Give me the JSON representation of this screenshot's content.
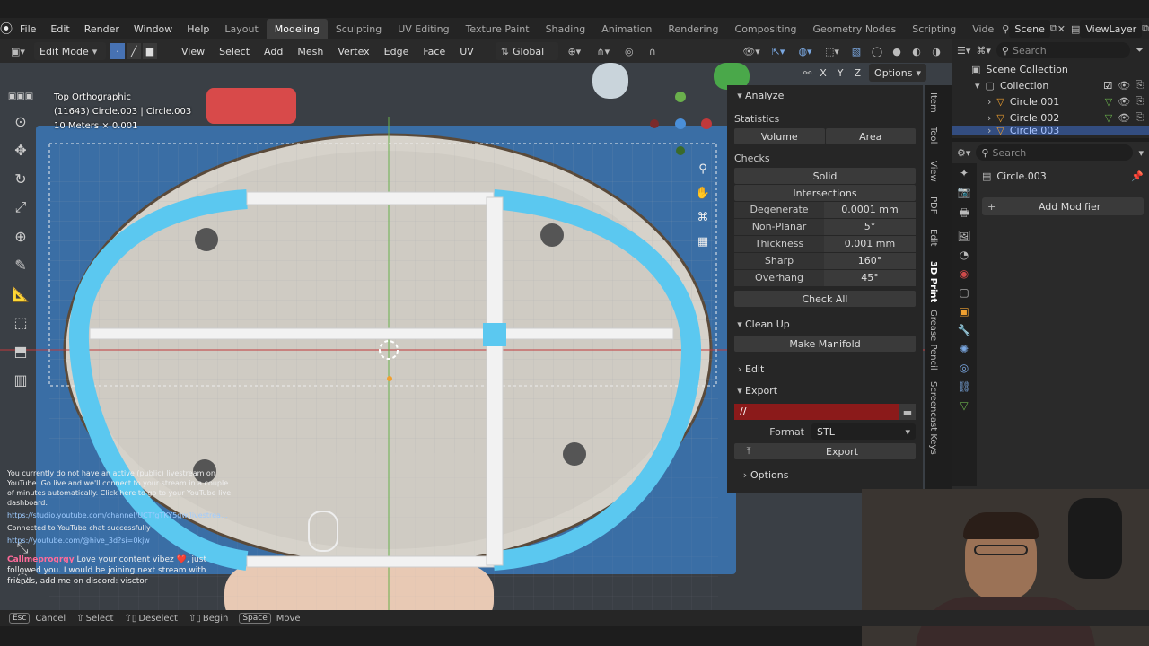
{
  "topbar": {
    "menus": [
      "File",
      "Edit",
      "Render",
      "Window",
      "Help"
    ],
    "workspaces": [
      "Layout",
      "Modeling",
      "Sculpting",
      "UV Editing",
      "Texture Paint",
      "Shading",
      "Animation",
      "Rendering",
      "Compositing",
      "Geometry Nodes",
      "Scripting",
      "Vide"
    ],
    "active_workspace": "Modeling",
    "scene": "Scene",
    "view_layer": "ViewLayer"
  },
  "header": {
    "mode": "Edit Mode",
    "menus": [
      "View",
      "Select",
      "Add",
      "Mesh",
      "Vertex",
      "Edge",
      "Face",
      "UV"
    ],
    "orientation": "Global",
    "axes": [
      "X",
      "Y",
      "Z"
    ],
    "options": "Options"
  },
  "viewport": {
    "view_name": "Top Orthographic",
    "object_info": "(11643) Circle.003 | Circle.003",
    "scale_info": "10 Meters × 0.001"
  },
  "npanel": {
    "analyze": "Analyze",
    "statistics": "Statistics",
    "volume": "Volume",
    "area": "Area",
    "checks": "Checks",
    "solid": "Solid",
    "intersections": "Intersections",
    "check_rows": [
      {
        "label": "Degenerate",
        "value": "0.0001 mm"
      },
      {
        "label": "Non-Planar",
        "value": "5°"
      },
      {
        "label": "Thickness",
        "value": "0.001 mm"
      },
      {
        "label": "Sharp",
        "value": "160°"
      },
      {
        "label": "Overhang",
        "value": "45°"
      }
    ],
    "check_all": "Check All",
    "clean_up": "Clean Up",
    "make_manifold": "Make Manifold",
    "edit": "Edit",
    "export_section": "Export",
    "export_path": "//",
    "format_label": "Format",
    "format_value": "STL",
    "export_button": "Export",
    "options": "Options"
  },
  "vtabs": [
    "Item",
    "Tool",
    "View",
    "PDF",
    "Edit",
    "3D Print",
    "Grease Pencil",
    "Screencast Keys"
  ],
  "outliner": {
    "search_placeholder": "Search",
    "scene_collection": "Scene Collection",
    "collection": "Collection",
    "items": [
      "Circle.001",
      "Circle.002",
      "Circle.003"
    ]
  },
  "properties": {
    "search_placeholder": "Search",
    "object_name": "Circle.003",
    "add_modifier": "Add Modifier"
  },
  "chat": {
    "line1": "You currently do not have an active (public) livestream on YouTube. Go live and we'll connect to your stream in a couple of minutes automatically. Click here to go to your YouTube live dashboard:",
    "line2": "https://studio.youtube.com/channel/UCTfgTKY5gw/livestreaming",
    "line3": "Connected to YouTube chat successfully",
    "line4": "https://youtube.com/@hive_3d?si=0kjw",
    "user": "Callmeprogrgy",
    "message": "Love your content vibez ❤️, just followed you. I would be joining next stream with friends, add me on discord: visctor"
  },
  "status": {
    "cancel_key": "Esc",
    "cancel": "Cancel",
    "select": "Select",
    "deselect": "Deselect",
    "begin": "Begin",
    "move_key": "Space",
    "move": "Move"
  },
  "colors": {
    "accent": "#4772b3",
    "selection_cyan": "#5bc8f0",
    "export_path_bg": "#8b1a1a"
  }
}
